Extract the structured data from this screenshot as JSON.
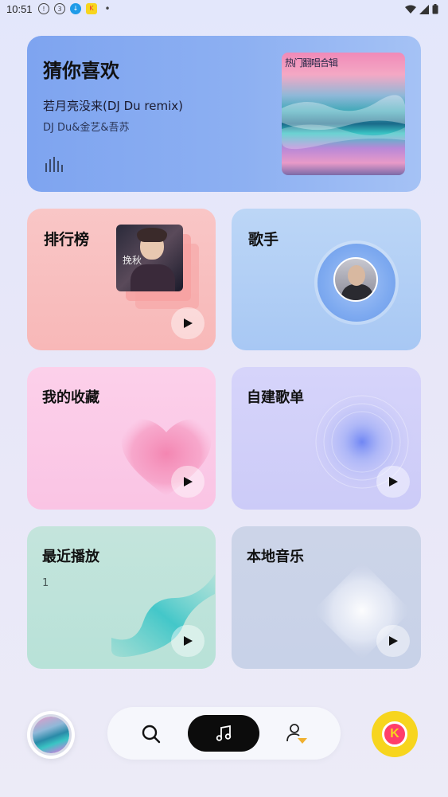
{
  "status_bar": {
    "time": "10:51"
  },
  "guess_you_like": {
    "title": "猜你喜欢",
    "song_title": "若月亮没来(DJ Du remix)",
    "artist": "DJ Du&金艺&吾苏",
    "album_cover_text": "热门翻唱合辑"
  },
  "ranking": {
    "title": "排行榜",
    "cover_text": "挽秋"
  },
  "singer": {
    "title": "歌手"
  },
  "my_collection": {
    "title": "我的收藏"
  },
  "self_playlist": {
    "title": "自建歌单"
  },
  "recent_play": {
    "title": "最近播放",
    "count": "1"
  },
  "local_music": {
    "title": "本地音乐"
  },
  "bottom_nav": {
    "search_icon": "search-icon",
    "music_icon": "music-note-icon",
    "user_icon": "user-vip-icon",
    "kugou_label": "K"
  },
  "colors": {
    "nav_active": "#0c0c0c",
    "kugou_yellow": "#f7d51e"
  }
}
